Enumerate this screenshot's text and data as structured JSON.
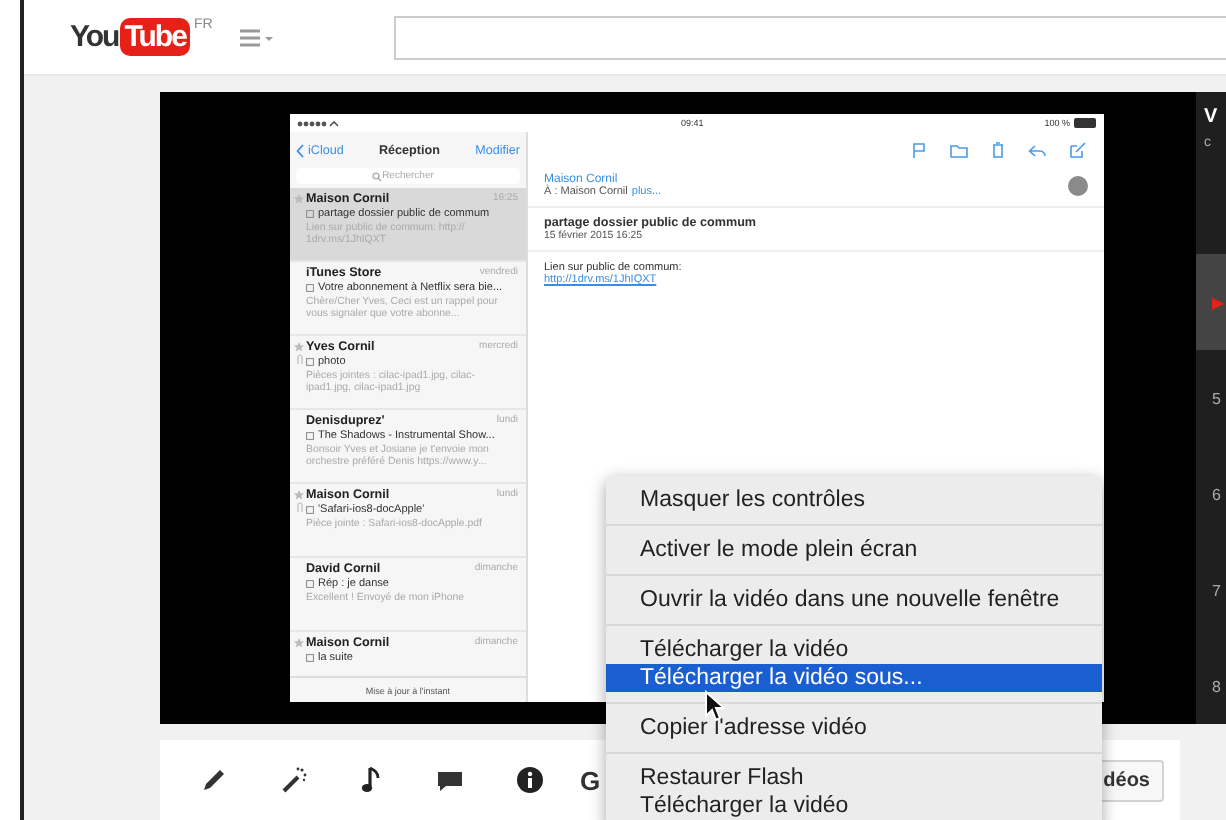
{
  "header": {
    "logo_left": "You",
    "logo_box": "Tube",
    "region": "FR"
  },
  "ipad": {
    "status_bar": {
      "time": "09:41",
      "battery": "100 %"
    },
    "list_nav": {
      "back": "iCloud",
      "title": "Réception",
      "action": "Modifier"
    },
    "search": {
      "placeholder": "Rechercher"
    },
    "mails": [
      {
        "sender": "Maison Cornil",
        "time": "16:25",
        "subject": "partage dossier public de commum",
        "preview": "Lien sur public de commum: http:// 1drv.ms/1JhIQXT",
        "starred": true,
        "attachment": false,
        "selected": true
      },
      {
        "sender": "iTunes Store",
        "time": "vendredi",
        "subject": "Votre abonnement à Netflix sera bie...",
        "preview": "Chère/Cher Yves, Ceci est un rappel pour vous signaler que votre abonne...",
        "starred": false,
        "attachment": false,
        "selected": false
      },
      {
        "sender": "Yves Cornil",
        "time": "mercredi",
        "subject": "photo",
        "preview": "Pièces jointes : cilac-ipad1.jpg, cilac-ipad1.jpg, cilac-ipad1.jpg",
        "starred": true,
        "attachment": true,
        "selected": false
      },
      {
        "sender": "Denisduprez'",
        "time": "lundi",
        "subject": "The Shadows - Instrumental Show...",
        "preview": "Bonsoir Yves et Josiane je t'envoie mon orchestre préféré Denis https://www.y...",
        "starred": false,
        "attachment": false,
        "selected": false
      },
      {
        "sender": "Maison Cornil",
        "time": "lundi",
        "subject": "'Safari-ios8-docApple'",
        "preview": "Pièce jointe : Safari-ios8-docApple.pdf",
        "starred": true,
        "attachment": true,
        "selected": false
      },
      {
        "sender": "David Cornil",
        "time": "dimanche",
        "subject": "Rép : je danse",
        "preview": "Excellent ! Envoyé de mon iPhone",
        "starred": false,
        "attachment": false,
        "selected": false
      },
      {
        "sender": "Maison Cornil",
        "time": "dimanche",
        "subject": "la suite",
        "starred": true,
        "attachment": false,
        "selected": false
      }
    ],
    "list_footer": "Mise à jour à l'instant",
    "message": {
      "from": "Maison Cornil",
      "to": "À : Maison Cornil",
      "to_more": "plus...",
      "subject": "partage dossier public de commum",
      "date": "15 février 2015 16:25",
      "body": "Lien sur public de commum:",
      "link": "http://1drv.ms/1JhIQXT"
    }
  },
  "playlist": {
    "title": "V",
    "subtitle": "c",
    "items": [
      {
        "label": "▶",
        "selected": true
      },
      {
        "label": "5",
        "selected": false
      },
      {
        "label": "6",
        "selected": false
      },
      {
        "label": "7",
        "selected": false
      },
      {
        "label": "8",
        "selected": false
      }
    ]
  },
  "toolbar": {
    "cut_label": "G",
    "button": "déos"
  },
  "context_menu": {
    "sections": [
      [
        {
          "label": "Masquer les contrôles",
          "selected": false
        }
      ],
      [
        {
          "label": "Activer le mode plein écran",
          "selected": false
        }
      ],
      [
        {
          "label": "Ouvrir la vidéo dans une nouvelle fenêtre",
          "selected": false
        }
      ],
      [
        {
          "label": "Télécharger la vidéo",
          "selected": false
        },
        {
          "label": "Télécharger la vidéo sous...",
          "selected": true
        }
      ],
      [
        {
          "label": "Copier l'adresse vidéo",
          "selected": false
        }
      ],
      [
        {
          "label": "Restaurer Flash",
          "selected": false
        },
        {
          "label": "Télécharger la vidéo",
          "selected": false
        }
      ]
    ]
  }
}
